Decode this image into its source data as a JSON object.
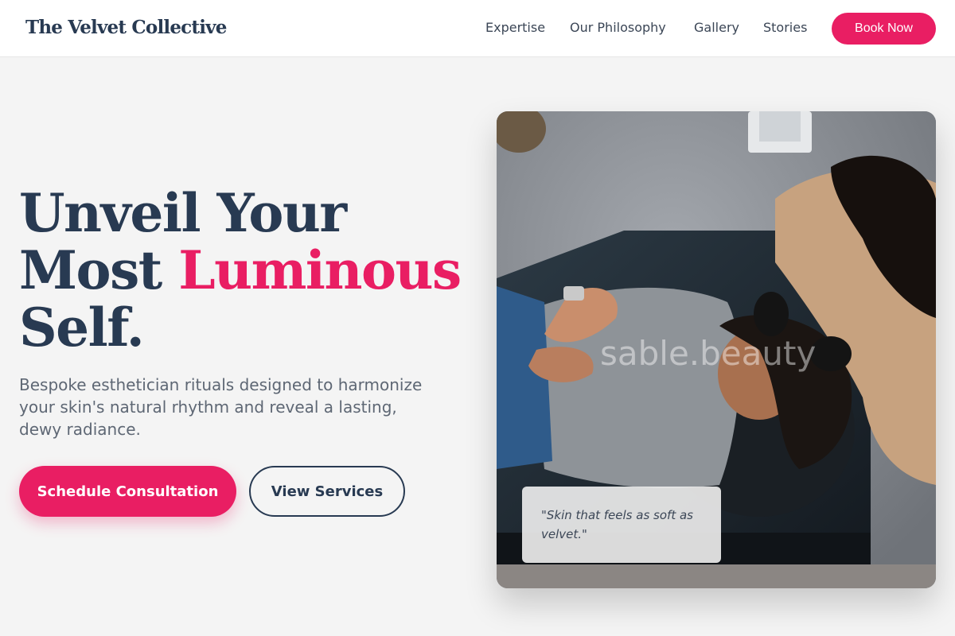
{
  "nav": {
    "brand": "The Velvet Collective",
    "links": [
      "Expertise",
      "Our Philosophy",
      "Gallery",
      "Stories"
    ],
    "cta": "Book Now"
  },
  "hero": {
    "headline_line1": "Unveil Your",
    "headline_line2_a": "Most ",
    "headline_line2_accent": "Luminous",
    "headline_line3": "Self.",
    "subtitle": "Bespoke esthetician rituals designed to harmonize your skin's natural rhythm and reveal a lasting, dewy radiance.",
    "primary_button": "Schedule Consultation",
    "secondary_button": "View Services"
  },
  "photo": {
    "watermark": "sable.beauty",
    "quote": "\"Skin that feels as soft as velvet.\""
  },
  "colors": {
    "accent": "#e91e63",
    "navy": "#283a52",
    "background": "#f4f4f4"
  }
}
